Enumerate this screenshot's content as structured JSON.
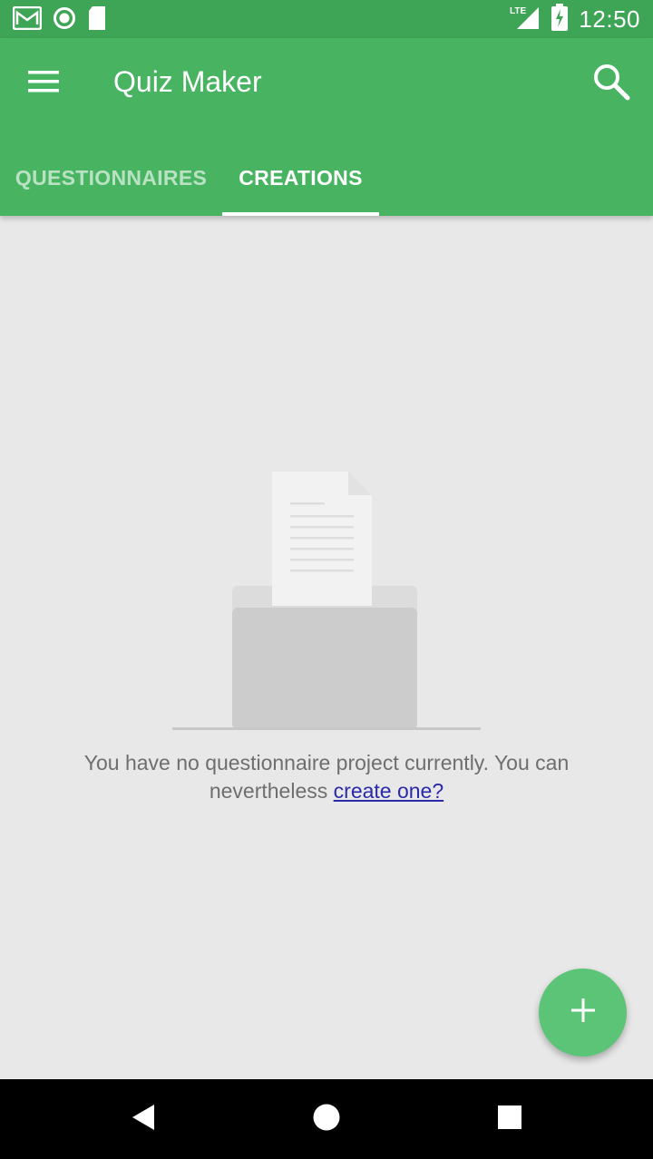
{
  "status_bar": {
    "time": "12:50",
    "network": "LTE",
    "icons": [
      "gmail-icon",
      "circle-notification-icon",
      "sd-card-icon",
      "lte-signal-icon",
      "battery-charging-icon"
    ]
  },
  "app_bar": {
    "title": "Quiz Maker",
    "menu_icon": "hamburger-menu-icon",
    "search_icon": "search-icon"
  },
  "tabs": [
    {
      "label": "QUESTIONNAIRES",
      "selected": false
    },
    {
      "label": "CREATIONS",
      "selected": true
    }
  ],
  "empty_state": {
    "message": "You have no questionnaire project currently. You can nevertheless",
    "link_label": "create one?",
    "illustration": "document-in-folder-illustration"
  },
  "fab": {
    "icon": "plus-icon"
  },
  "nav_bar": {
    "icons": [
      "back-icon",
      "home-icon",
      "recent-apps-icon"
    ]
  },
  "colors": {
    "status_bar": "#3fa556",
    "app_bar": "#48b462",
    "fab": "#5bc476",
    "background": "#e8e8e8",
    "link": "#2a2aa8"
  }
}
